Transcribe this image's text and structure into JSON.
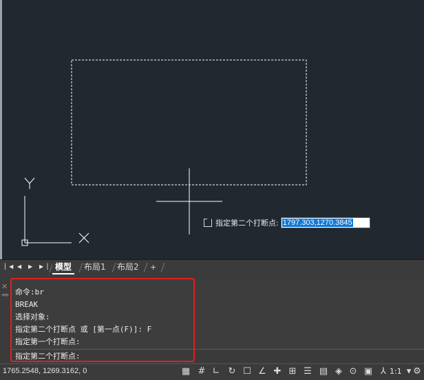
{
  "canvas": {
    "ucs_y_label": "Y",
    "dynamic_prompt": {
      "label": "指定第二个打断点:",
      "value": "1797.303,1270.3845"
    }
  },
  "tabs": {
    "model": "模型",
    "layout1": "布局1",
    "layout2": "布局2",
    "add": "+"
  },
  "command": {
    "history": [
      "命令:br",
      "BREAK",
      "选择对象:",
      "指定第二个打断点 或 [第一点(F)]: F",
      "指定第一个打断点:"
    ],
    "current_prompt": "指定第二个打断点:"
  },
  "status": {
    "coordinates": "1765.2548, 1269.3162, 0",
    "annotation_scale": "1:1"
  },
  "colors": {
    "canvas_bg": "#212830",
    "highlight": "#e02020",
    "selection_blue": "#0e78d7"
  }
}
